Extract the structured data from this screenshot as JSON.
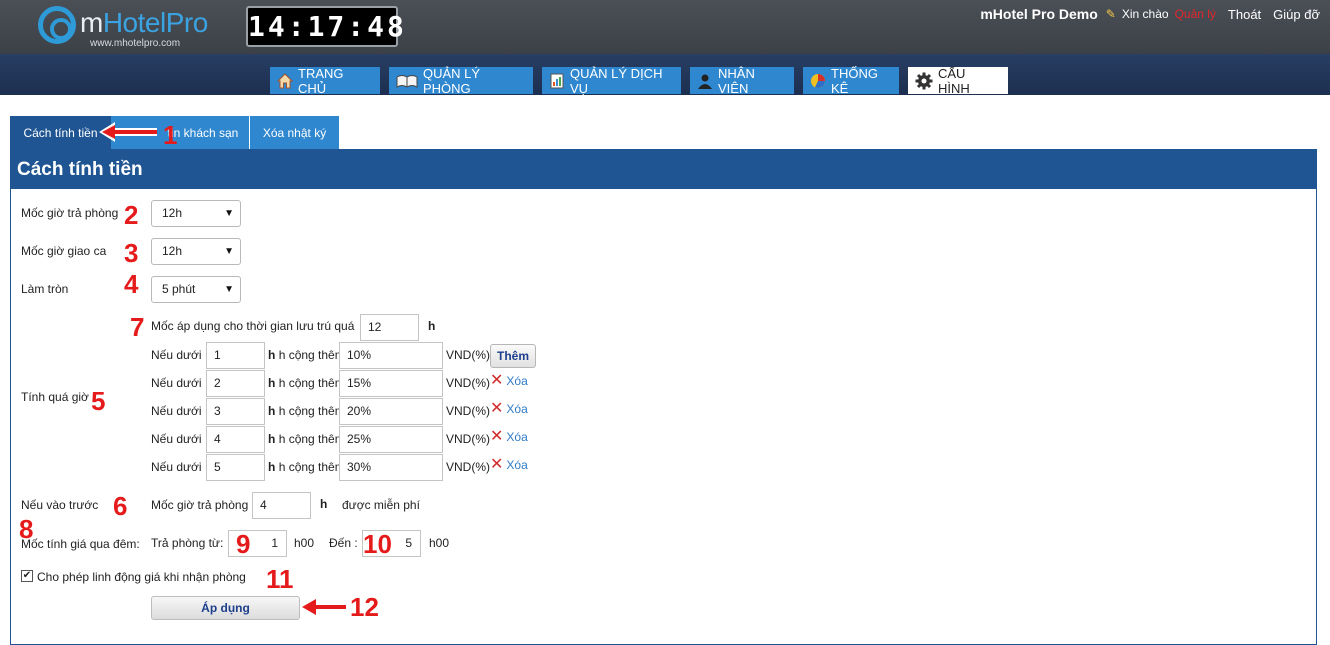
{
  "header": {
    "logo_text_m": "m",
    "logo_text": "HotelPro",
    "logo_url": "www.mhotelpro.com",
    "clock": "14:17:48",
    "brand": "mHotel Pro Demo",
    "greeting": "Xin chào",
    "user": "Quản lý",
    "logout": "Thoát",
    "help": "Giúp đỡ"
  },
  "nav": [
    {
      "label": "TRANG CHỦ",
      "icon": "home-icon"
    },
    {
      "label": "QUẢN LÝ PHÒNG",
      "icon": "book-icon"
    },
    {
      "label": "QUẢN LÝ DỊCH VỤ",
      "icon": "document-icon"
    },
    {
      "label": "NHÂN VIÊN",
      "icon": "person-icon"
    },
    {
      "label": "THỐNG KÊ",
      "icon": "pie-chart-icon"
    },
    {
      "label": "CẤU HÌNH",
      "icon": "gear-icon"
    }
  ],
  "tabs": [
    {
      "label": "Cách tính tiền"
    },
    {
      "label": "tin khách sạn"
    },
    {
      "label": "Xóa nhật ký"
    }
  ],
  "panel": {
    "title": "Cách tính tiền",
    "checkout_label": "Mốc giờ trả phòng",
    "checkout_value": "12h",
    "shift_label": "Mốc giờ giao ca",
    "shift_value": "12h",
    "round_label": "Làm tròn",
    "round_value": "5 phút",
    "overtime_label": "Tính quá giờ",
    "threshold_label": "Mốc áp dụng cho thời gian lưu trú quá",
    "threshold_value": "12",
    "unit_h": "h",
    "row_prefix": "Nếu dưới",
    "row_mid": "h cộng thêm",
    "row_suffix": "VND(%)",
    "add_label": "Thêm",
    "delete_label": "Xóa",
    "rows": [
      {
        "hours": "1",
        "percent": "10%"
      },
      {
        "hours": "2",
        "percent": "15%"
      },
      {
        "hours": "3",
        "percent": "20%"
      },
      {
        "hours": "4",
        "percent": "25%"
      },
      {
        "hours": "5",
        "percent": "30%"
      }
    ],
    "early_label": "Nếu vào trước",
    "early_mid": "Mốc giờ trả phòng",
    "early_value": "4",
    "early_suffix": "được miễn phí",
    "night_label": "Mốc tính giá qua đêm:",
    "night_from_label": "Trả phòng từ:",
    "night_from_value": "1",
    "night_from_unit": "h00",
    "night_to_label": "Đến :",
    "night_to_value": "5",
    "night_to_unit": "h00",
    "flex_label": "Cho phép linh động giá khi nhận phòng",
    "apply_label": "Áp dụng"
  },
  "annotations": [
    "1",
    "2",
    "3",
    "4",
    "5",
    "6",
    "7",
    "8",
    "9",
    "10",
    "11",
    "12"
  ],
  "colors": {
    "header_bg": "#3f434a",
    "nav_bg": "#22365a",
    "nav_item": "#2f87cf",
    "panel_head": "#1f5592",
    "annotation": "#e51a1a"
  }
}
